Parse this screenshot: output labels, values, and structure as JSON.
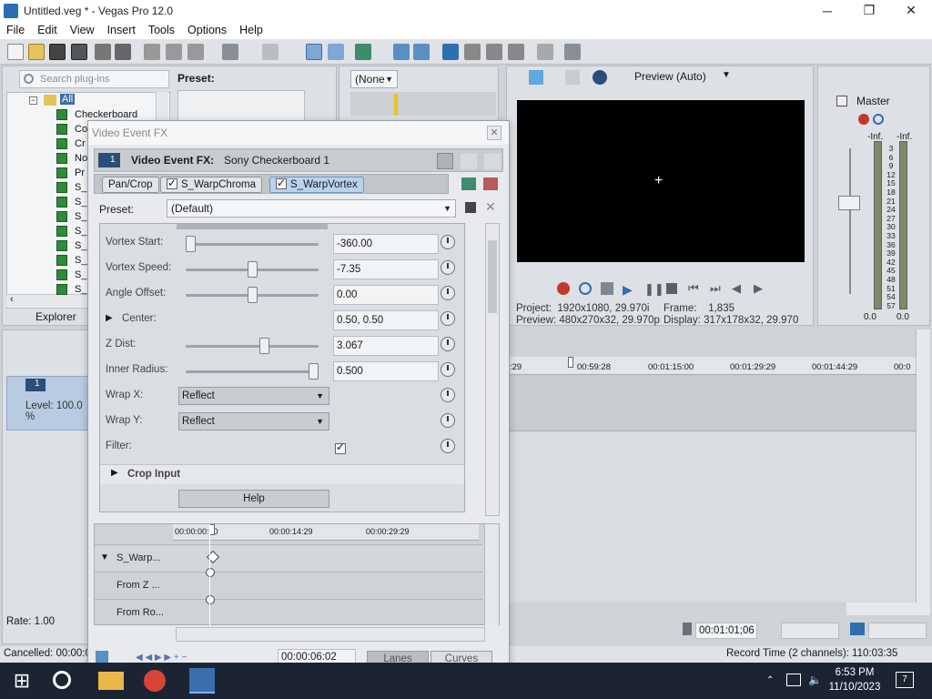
{
  "window": {
    "title": "Untitled.veg * - Vegas Pro 12.0",
    "minimize": "─",
    "maximize": "❐",
    "close": "✕"
  },
  "menu": [
    "File",
    "Edit",
    "View",
    "Insert",
    "Tools",
    "Options",
    "Help"
  ],
  "plugins": {
    "search_placeholder": "Search plug-ins",
    "preset_label": "Preset:",
    "tree_root": "All",
    "items": [
      "Checkerboard",
      "Co",
      "Cr",
      "No",
      "Pr",
      "S_",
      "S_",
      "S_",
      "S_",
      "S_",
      "S_",
      "S_",
      "S_"
    ],
    "tab_label": "Explorer"
  },
  "trimmer": {
    "none_dropdown": "(None"
  },
  "fx_dialog": {
    "title": "Video Event FX",
    "header_label": "Video Event FX:",
    "header_value": "Sony Checkerboard 1",
    "chips": [
      "Pan/Crop",
      "S_WarpChroma",
      "S_WarpVortex"
    ],
    "preset_label": "Preset:",
    "preset_value": "(Default)",
    "params": [
      {
        "label": "Vortex Start:",
        "value": "-360.00",
        "level": 0.0
      },
      {
        "label": "Vortex Speed:",
        "value": "-7.35",
        "level": 0.5
      },
      {
        "label": "Angle Offset:",
        "value": "0.00",
        "level": 0.5
      },
      {
        "label": "Center:",
        "value": "0.50, 0.50"
      },
      {
        "label": "Z Dist:",
        "value": "3.067",
        "level": 0.6
      },
      {
        "label": "Inner Radius:",
        "value": "0.500",
        "level": 1.0
      },
      {
        "label": "Wrap X:",
        "value": "Reflect"
      },
      {
        "label": "Wrap Y:",
        "value": "Reflect"
      },
      {
        "label": "Filter:",
        "value": ""
      }
    ],
    "crop_input": "Crop Input",
    "help": "Help",
    "timeline": {
      "ticks": [
        "00:00:00:00",
        "00:00:14:29",
        "00:00:29:29"
      ],
      "rows": [
        "S_Warp...",
        "From Z ...",
        "From Ro..."
      ]
    },
    "bottom_time": "00:00:06:02",
    "tabs": [
      "Lanes",
      "Curves"
    ]
  },
  "preview": {
    "mode": "Preview (Auto)",
    "project_label": "Project:",
    "project_value": "1920x1080, 29.970i",
    "preview_label": "Preview:",
    "preview_value": "480x270x32, 29.970p",
    "frame_label": "Frame:",
    "frame_value": "1,835",
    "display_label": "Display:",
    "display_value": "317x178x32, 29.970"
  },
  "master": {
    "label": "Master",
    "peak_left": "-Inf.",
    "peak_right": "-Inf.",
    "scale": [
      "3",
      "6",
      "9",
      "12",
      "15",
      "18",
      "21",
      "24",
      "27",
      "30",
      "33",
      "36",
      "39",
      "42",
      "45",
      "48",
      "51",
      "54",
      "57"
    ],
    "val_left": "0.0",
    "val_right": "0.0"
  },
  "track": {
    "number": "1",
    "level": "Level: 100.0 %"
  },
  "timeline_ruler": [
    "00:59:28",
    "00:01:15:00",
    "00:01:29:29",
    "00:01:44:29",
    "00:0"
  ],
  "ruler_left": ":29",
  "rate": "Rate: 1.00",
  "cursor_time": "00:01:01;06",
  "status": {
    "left": "Cancelled: 00:00:0",
    "right": "Record Time (2 channels): 110:03:35"
  },
  "taskbar": {
    "time": "6:53 PM",
    "date": "11/10/2023",
    "notifications": "7"
  }
}
